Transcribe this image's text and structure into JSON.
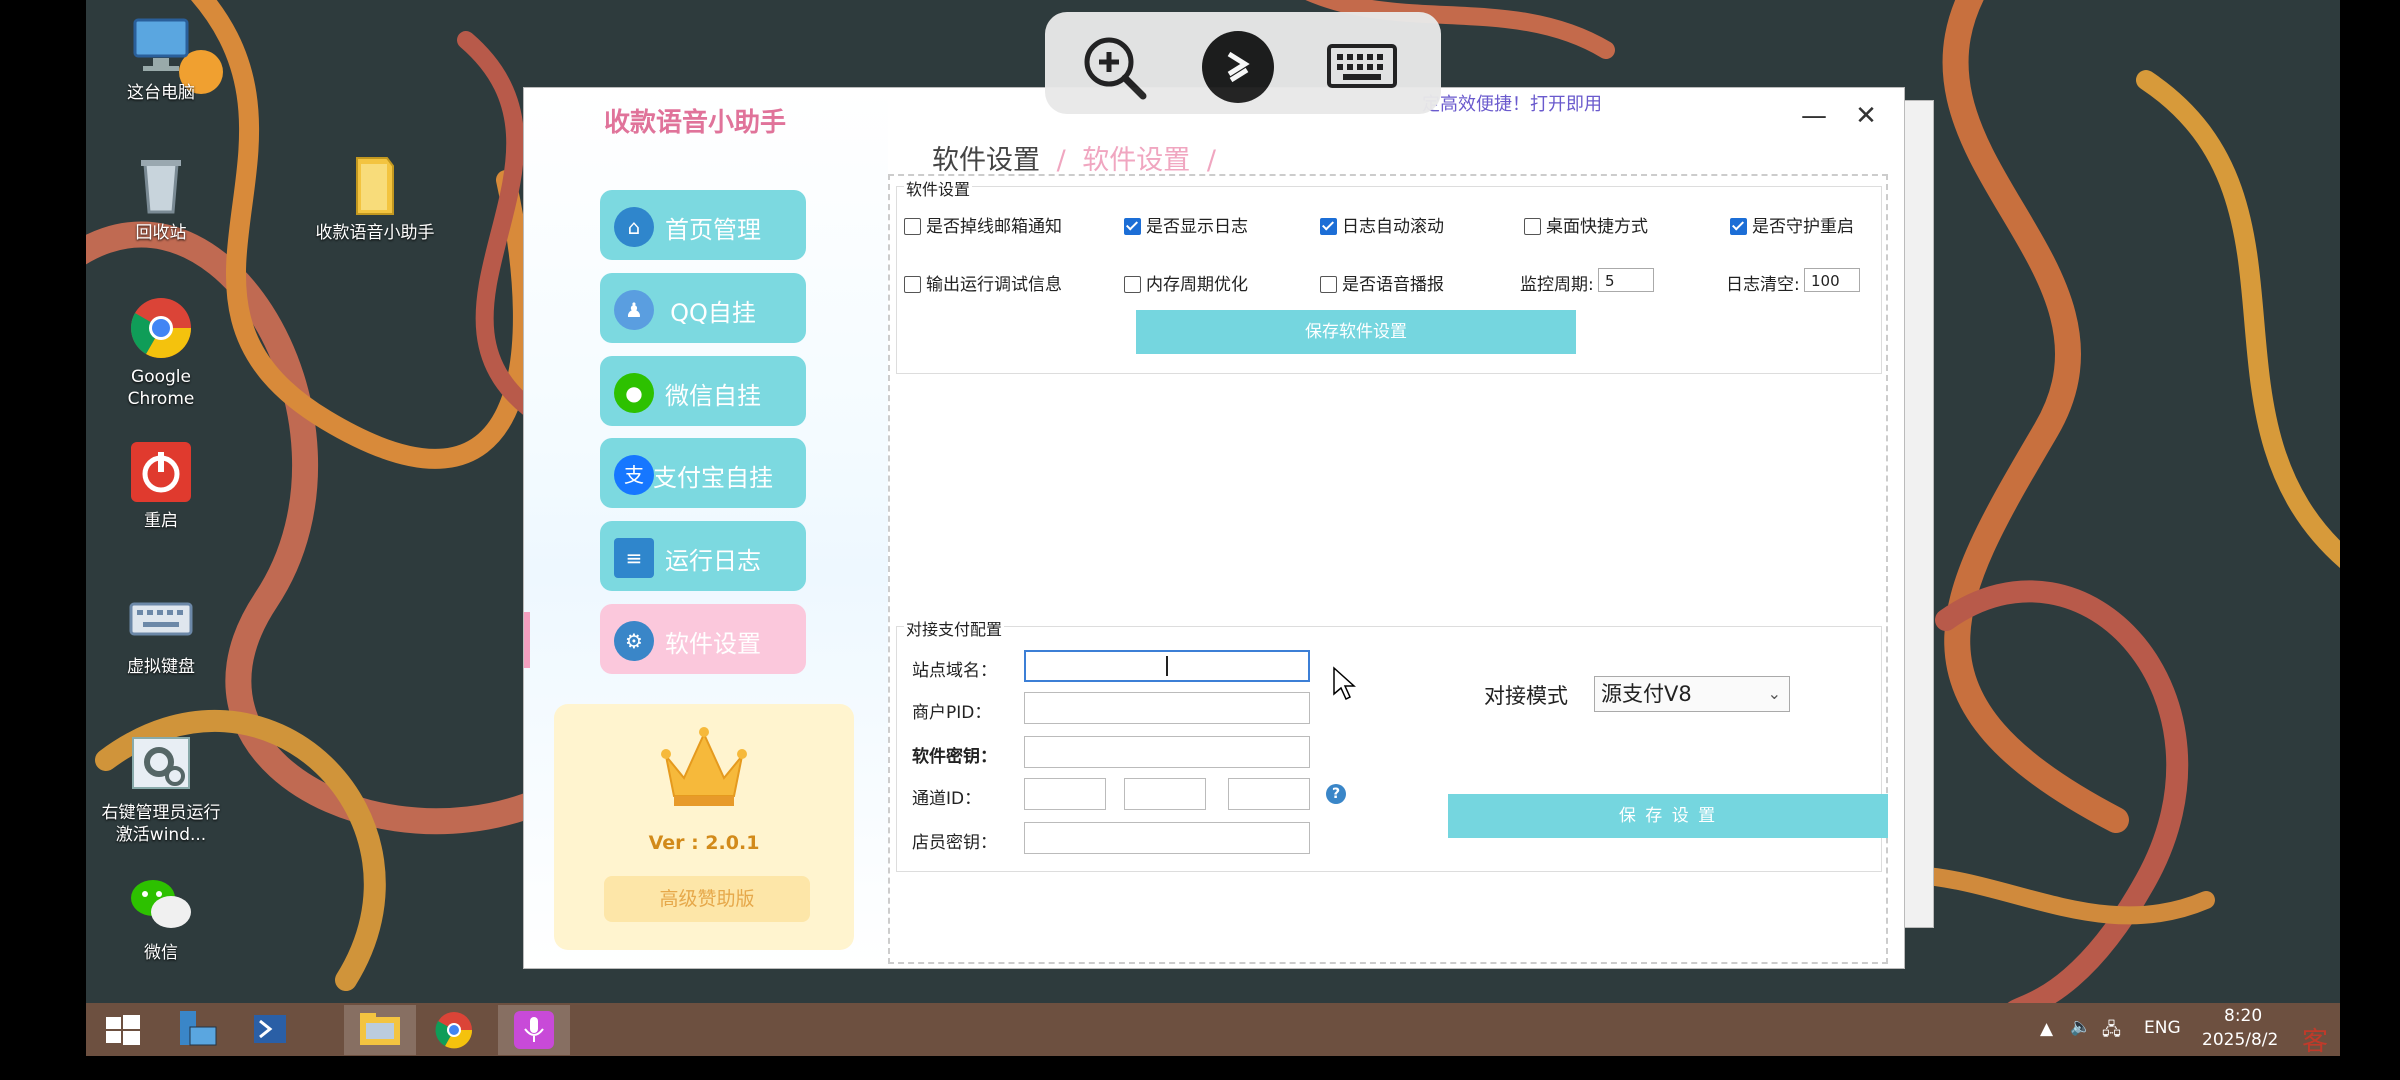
{
  "desktop": {
    "icons": [
      {
        "label": "这台电脑",
        "icon": "computer-icon"
      },
      {
        "label": "回收站",
        "icon": "recycle-bin-icon"
      },
      {
        "label": "收款语音小助手",
        "icon": "folder-icon"
      },
      {
        "label": "Google Chrome",
        "icon": "chrome-icon"
      },
      {
        "label": "重启",
        "icon": "power-icon"
      },
      {
        "label": "虚拟键盘",
        "icon": "keyboard-icon"
      },
      {
        "label": "右键管理员运行激活wind...",
        "icon": "settings-app-icon"
      },
      {
        "label": "微信",
        "icon": "wechat-icon"
      }
    ]
  },
  "remote_toolbar": {
    "icons": [
      "zoom-in-icon",
      "remote-connect-icon",
      "keyboard-icon"
    ]
  },
  "taskbar": {
    "clock_time": "8:20",
    "clock_date": "2025/8/2",
    "lang": "ENG",
    "watermark": "客"
  },
  "app": {
    "title": "收款语音小助手",
    "top_link": "定高效便捷！打开即用",
    "minimize": "—",
    "close": "✕",
    "nav": [
      {
        "label": "首页管理",
        "icon": "home-icon",
        "active": false
      },
      {
        "label": "QQ自挂",
        "icon": "qq-icon",
        "active": false
      },
      {
        "label": "微信自挂",
        "icon": "wechat-icon",
        "active": false
      },
      {
        "label": "支付宝自挂",
        "icon": "alipay-icon",
        "active": false
      },
      {
        "label": "运行日志",
        "icon": "log-icon",
        "active": false
      },
      {
        "label": "软件设置",
        "icon": "gear-icon",
        "active": true
      }
    ],
    "version": "Ver : 2.0.1",
    "premium_label": "高级赞助版",
    "breadcrumb": {
      "root": "软件设置",
      "sep": "/",
      "current": "软件设置"
    },
    "software_settings": {
      "title": "软件设置",
      "checkboxes": [
        {
          "label": "是否掉线邮箱通知",
          "checked": false
        },
        {
          "label": "是否显示日志",
          "checked": true
        },
        {
          "label": "日志自动滚动",
          "checked": true
        },
        {
          "label": "桌面快捷方式",
          "checked": false
        },
        {
          "label": "是否守护重启",
          "checked": true
        },
        {
          "label": "输出运行调试信息",
          "checked": false
        },
        {
          "label": "内存周期优化",
          "checked": false
        },
        {
          "label": "是否语音播报",
          "checked": false
        }
      ],
      "monitor_label": "监控周期:",
      "monitor_value": "5",
      "log_clear_label": "日志清空:",
      "log_clear_value": "100",
      "save_button": "保存软件设置"
    },
    "payment_config": {
      "title": "对接支付配置",
      "site_label": "站点域名：",
      "site_value": "",
      "pid_label": "商户PID：",
      "key_label": "软件密钥：",
      "channel_label": "通道ID：",
      "help": "?",
      "clerk_label": "店员密钥：",
      "mode_label": "对接模式",
      "mode_value": "源支付V8",
      "save_button": "保 存 设 置"
    }
  }
}
